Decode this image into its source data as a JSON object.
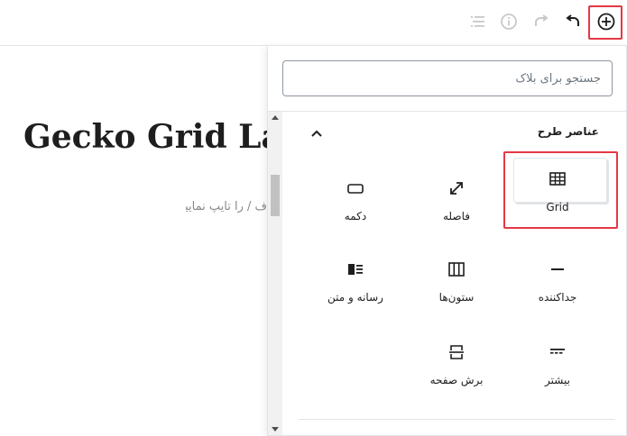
{
  "toolbar": {
    "icons": [
      "table-of-contents-icon",
      "info-icon",
      "redo-icon",
      "undo-icon",
      "add-block-icon"
    ]
  },
  "editor": {
    "title": "Gecko Grid Lay",
    "placeholder": "ف / را تایپ نمایید"
  },
  "inserter": {
    "search_placeholder": "جستجو برای بلاک",
    "category_title": "عناصر طرح",
    "blocks": [
      {
        "label": "Grid",
        "icon": "grid-icon"
      },
      {
        "label": "فاصله",
        "icon": "spacer-icon"
      },
      {
        "label": "دکمه",
        "icon": "button-icon"
      },
      {
        "label": "جداکننده",
        "icon": "separator-icon"
      },
      {
        "label": "ستون‌ها",
        "icon": "columns-icon"
      },
      {
        "label": "رسانه و متن",
        "icon": "media-text-icon"
      },
      {
        "label": "بیشتر",
        "icon": "more-icon"
      },
      {
        "label": "برش صفحه",
        "icon": "page-break-icon"
      }
    ]
  },
  "colors": {
    "highlight": "#e53945",
    "icon": "#1e1e1e",
    "icon_disabled": "#c6c9cc"
  }
}
